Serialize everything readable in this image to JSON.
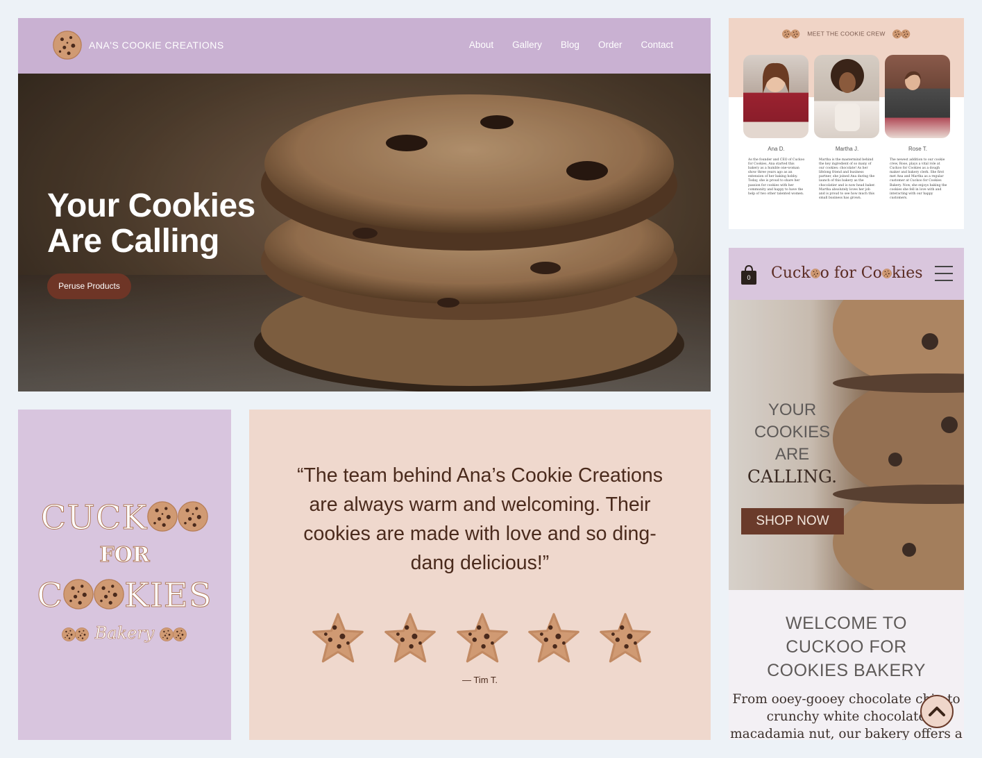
{
  "hero": {
    "brand": "ANA'S COOKIE CREATIONS",
    "nav": [
      "About",
      "Gallery",
      "Blog",
      "Order",
      "Contact"
    ],
    "headline_line1": "Your Cookies",
    "headline_line2": "Are Calling",
    "cta": "Peruse Products",
    "nav_bg": "#c9b1d2",
    "cta_color": "#6e3526"
  },
  "crew": {
    "heading": "MEET THE COOKIE CREW",
    "members": [
      {
        "name": "Ana D.",
        "bio": "As the founder and CEO of Cuckoo for Cookies, Ana started this bakery as a humble one-woman show three years ago as an extension of her baking hobby. Today, she is proud to share her passion for cookies with her community and happy to have the help of two other talented women."
      },
      {
        "name": "Martha J.",
        "bio": "Martha is the mastermind behind the key ingredient of so many of our cookies: chocolate! As her lifelong friend and business partner, she joined Ana during the launch of this bakery as the chocolatier and is now head baker. Martha absolutely loves her job and is proud to see how much this small business has grown."
      },
      {
        "name": "Rose T.",
        "bio": "The newest addition to our cookie crew, Rose, plays a vital role at Cuckoo for Cookies as a dough maker and bakery clerk. She first met Ana and Martha as a regular customer at Cuckoo for Cookies Bakery. Now, she enjoys baking the cookies she fell in love with and interacting with our happy customers."
      }
    ]
  },
  "logo_card": {
    "line1": "CUCK",
    "line2": "FOR",
    "line3_a": "C",
    "line3_b": "KIES",
    "script": "Bakery"
  },
  "testimonial": {
    "quote": "“The team behind Ana’s Cookie Creations are always warm and welcoming. Their cookies are made with love and so ding-dang delicious!”",
    "rating": 5,
    "author": "— Tim T."
  },
  "mobile": {
    "bag_count": "0",
    "title_a": "Cuck",
    "title_b": "o for Co",
    "title_c": "kies",
    "hero_1": "YOUR",
    "hero_2": "COOKIES",
    "hero_3": "ARE",
    "hero_4": "CALLING.",
    "shop": "SHOP NOW",
    "welcome_1": "WELCOME TO",
    "welcome_2": "CUCKOO FOR",
    "welcome_3": "COOKIES BAKERY",
    "copy": "From ooey-gooey chocolate chip to crunchy white chocolate macadamia nut, our bakery offers a variety of"
  }
}
